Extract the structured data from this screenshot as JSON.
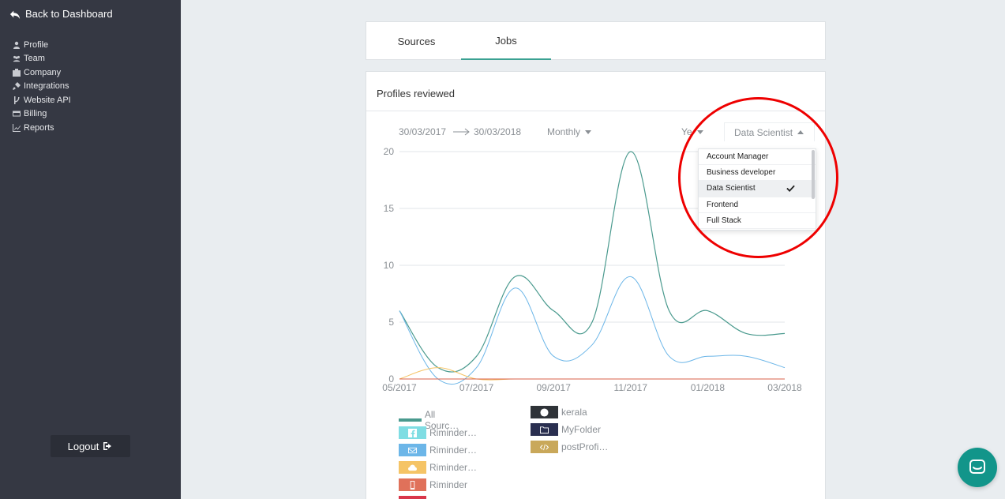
{
  "sidebar": {
    "back_label": "Back to Dashboard",
    "items": [
      {
        "label": "Profile",
        "icon": "user-icon"
      },
      {
        "label": "Team",
        "icon": "users-icon"
      },
      {
        "label": "Company",
        "icon": "building-icon"
      },
      {
        "label": "Integrations",
        "icon": "plug-icon"
      },
      {
        "label": "Website API",
        "icon": "code-branch-icon"
      },
      {
        "label": "Billing",
        "icon": "credit-card-icon"
      },
      {
        "label": "Reports",
        "icon": "line-chart-icon"
      }
    ],
    "logout_label": "Logout"
  },
  "tabs": [
    {
      "label": "Sources",
      "active": false
    },
    {
      "label": "Jobs",
      "active": true
    }
  ],
  "card": {
    "title": "Profiles reviewed",
    "date_from": "30/03/2017",
    "date_to": "30/03/2018",
    "interval": "Monthly",
    "year_label": "Ye",
    "selected_job": "Data Scientist"
  },
  "dropdown": {
    "options": [
      "Account Manager",
      "Business developer",
      "Data Scientist",
      "Frontend",
      "Full Stack"
    ],
    "selected_index": 2
  },
  "colors": {
    "accent": "#3aa192",
    "sidebar_bg": "#353843",
    "annotation": "#ee0000",
    "series_all": "#4a9a8e",
    "series_blue": "#6cb6e8",
    "series_orange": "#f5c466",
    "series_red": "#d9604a"
  },
  "chart_data": {
    "type": "line",
    "x": [
      "05/2017",
      "06/2017",
      "07/2017",
      "08/2017",
      "09/2017",
      "10/2017",
      "11/2017",
      "12/2017",
      "01/2018",
      "02/2018",
      "03/2018"
    ],
    "x_tick_labels": [
      "05/2017",
      "07/2017",
      "09/2017",
      "11/2017",
      "01/2018",
      "03/2018"
    ],
    "ylim": [
      0,
      20
    ],
    "y_ticks": [
      0,
      5,
      10,
      15,
      20
    ],
    "grid": true,
    "series": [
      {
        "name": "All Sources",
        "color": "#4a9a8e",
        "values": [
          6,
          1,
          2,
          9,
          6,
          5,
          20,
          6,
          6,
          4,
          4
        ]
      },
      {
        "name": "",
        "color": "#6cb6e8",
        "values": [
          6,
          0,
          1,
          8,
          2,
          3,
          9,
          2,
          2,
          2,
          1
        ]
      },
      {
        "name": "",
        "color": "#f5c466",
        "values": [
          0,
          1,
          0,
          0,
          0,
          0,
          0,
          0,
          0,
          0,
          0
        ]
      },
      {
        "name": "",
        "color": "#d9604a",
        "values": [
          0,
          0,
          0,
          0,
          0,
          0,
          0,
          0,
          0,
          0,
          0
        ]
      }
    ]
  },
  "legend": {
    "left": [
      {
        "label": "All Sourc…",
        "kind": "line",
        "color": "#4a9a8e"
      },
      {
        "label": "Riminder…",
        "kind": "swatch",
        "color": "#7fdde3",
        "icon": "facebook-icon"
      },
      {
        "label": "Riminder…",
        "kind": "swatch",
        "color": "#6cb6e8",
        "icon": "envelope-icon"
      },
      {
        "label": "Riminder…",
        "kind": "swatch",
        "color": "#f5c466",
        "icon": "cloud-upload-icon"
      },
      {
        "label": "Riminder",
        "kind": "swatch",
        "color": "#e0715a",
        "icon": "tablet-icon"
      }
    ],
    "right": [
      {
        "label": "kerala",
        "color": "#2f3338",
        "icon": "globe-icon"
      },
      {
        "label": "MyFolder",
        "color": "#2a2f50",
        "icon": "folder-icon"
      },
      {
        "label": "postProfi…",
        "color": "#c9a85a",
        "icon": "code-icon"
      }
    ]
  }
}
